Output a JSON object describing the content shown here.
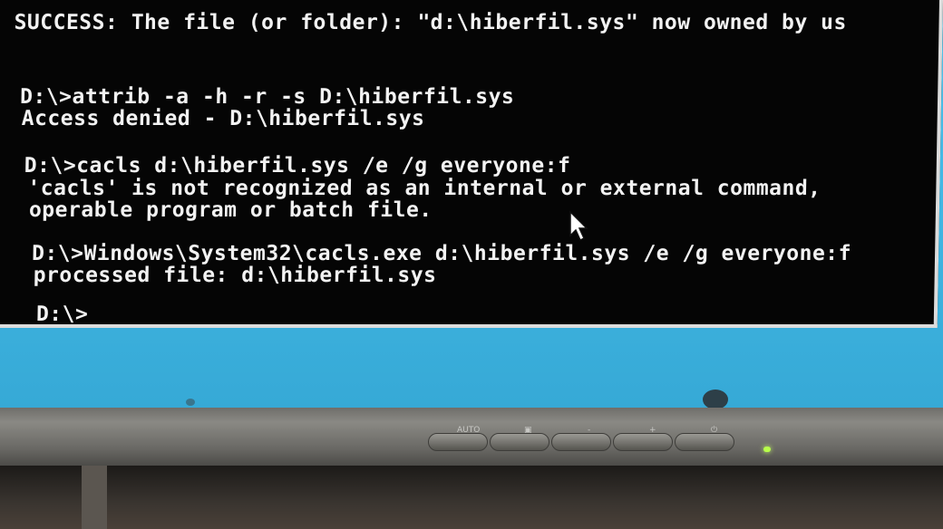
{
  "console": {
    "lines": [
      "SUCCESS: The file (or folder): \"d:\\hiberfil.sys\" now owned by us",
      "D:\\>attrib -a -h -r -s D:\\hiberfil.sys",
      "Access denied - D:\\hiberfil.sys",
      "D:\\>cacls d:\\hiberfil.sys /e /g everyone:f",
      "'cacls' is not recognized as an internal or external command,",
      "operable program or batch file.",
      "D:\\>Windows\\System32\\cacls.exe d:\\hiberfil.sys /e /g everyone:f",
      "processed file: d:\\hiberfil.sys",
      "D:\\>"
    ]
  },
  "monitor": {
    "buttons": [
      "AUTO",
      "",
      "-",
      "+",
      ""
    ],
    "led_color": "#b8ff4a"
  }
}
